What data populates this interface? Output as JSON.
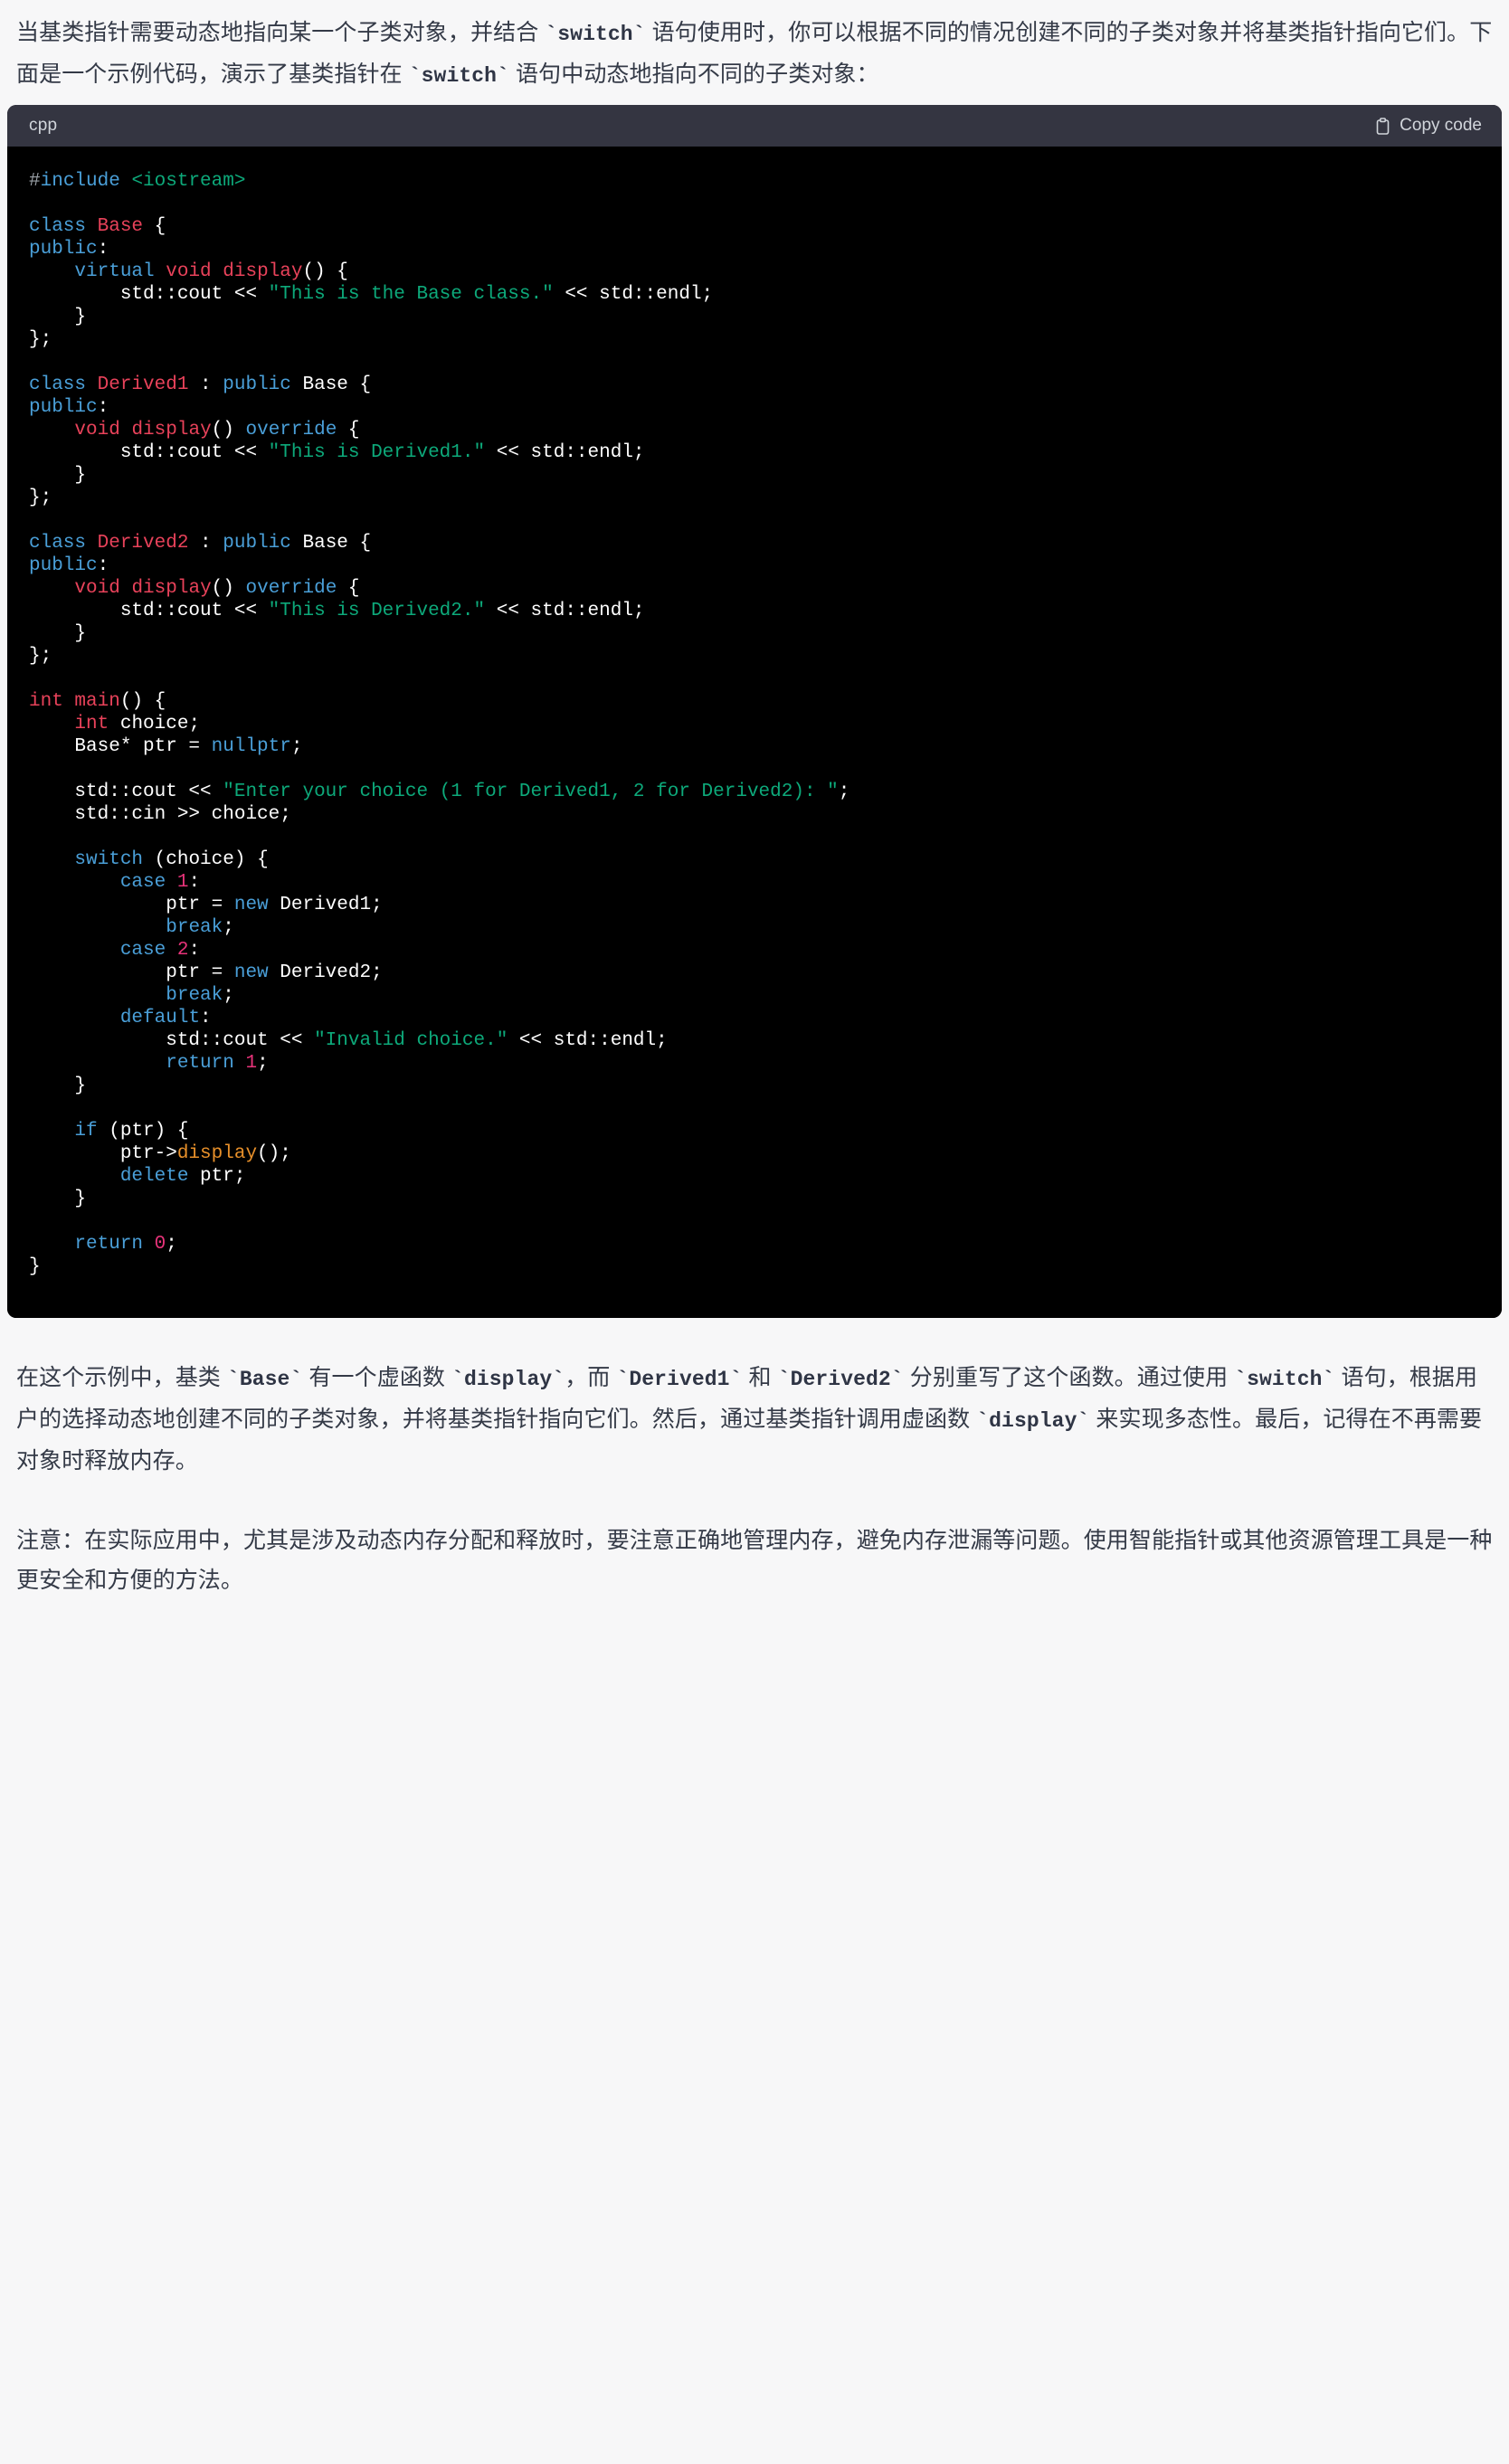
{
  "intro": {
    "paragraph": "当基类指针需要动态地指向某一个子类对象，并结合 `switch` 语句使用时，你可以根据不同的情况创建不同的子类对象并将基类指针指向它们。下面是一个示例代码，演示了基类指针在 `switch` 语句中动态地指向不同的子类对象："
  },
  "code_block": {
    "language_label": "cpp",
    "copy_label": "Copy code",
    "copy_icon": "clipboard-icon",
    "header_bg": "#343541",
    "body_bg": "#000000",
    "lines": [
      [
        {
          "t": "hash",
          "s": "#"
        },
        {
          "t": "kw",
          "s": "include"
        },
        {
          "t": "plain",
          "s": " "
        },
        {
          "t": "str",
          "s": "<iostream>"
        }
      ],
      [],
      [
        {
          "t": "kw",
          "s": "class"
        },
        {
          "t": "plain",
          "s": " "
        },
        {
          "t": "type",
          "s": "Base"
        },
        {
          "t": "plain",
          "s": " {"
        }
      ],
      [
        {
          "t": "kw",
          "s": "public"
        },
        {
          "t": "plain",
          "s": ":"
        }
      ],
      [
        {
          "t": "plain",
          "s": "    "
        },
        {
          "t": "kw",
          "s": "virtual"
        },
        {
          "t": "plain",
          "s": " "
        },
        {
          "t": "type",
          "s": "void"
        },
        {
          "t": "plain",
          "s": " "
        },
        {
          "t": "type",
          "s": "display"
        },
        {
          "t": "plain",
          "s": "() {"
        }
      ],
      [
        {
          "t": "plain",
          "s": "        std::cout << "
        },
        {
          "t": "str",
          "s": "\"This is the Base class.\""
        },
        {
          "t": "plain",
          "s": " << std::endl;"
        }
      ],
      [
        {
          "t": "plain",
          "s": "    }"
        }
      ],
      [
        {
          "t": "plain",
          "s": "};"
        }
      ],
      [],
      [
        {
          "t": "kw",
          "s": "class"
        },
        {
          "t": "plain",
          "s": " "
        },
        {
          "t": "type",
          "s": "Derived1"
        },
        {
          "t": "plain",
          "s": " : "
        },
        {
          "t": "kw",
          "s": "public"
        },
        {
          "t": "plain",
          "s": " Base {"
        }
      ],
      [
        {
          "t": "kw",
          "s": "public"
        },
        {
          "t": "plain",
          "s": ":"
        }
      ],
      [
        {
          "t": "plain",
          "s": "    "
        },
        {
          "t": "type",
          "s": "void"
        },
        {
          "t": "plain",
          "s": " "
        },
        {
          "t": "type",
          "s": "display"
        },
        {
          "t": "plain",
          "s": "() "
        },
        {
          "t": "kw",
          "s": "override"
        },
        {
          "t": "plain",
          "s": " {"
        }
      ],
      [
        {
          "t": "plain",
          "s": "        std::cout << "
        },
        {
          "t": "str",
          "s": "\"This is Derived1.\""
        },
        {
          "t": "plain",
          "s": " << std::endl;"
        }
      ],
      [
        {
          "t": "plain",
          "s": "    }"
        }
      ],
      [
        {
          "t": "plain",
          "s": "};"
        }
      ],
      [],
      [
        {
          "t": "kw",
          "s": "class"
        },
        {
          "t": "plain",
          "s": " "
        },
        {
          "t": "type",
          "s": "Derived2"
        },
        {
          "t": "plain",
          "s": " : "
        },
        {
          "t": "kw",
          "s": "public"
        },
        {
          "t": "plain",
          "s": " Base {"
        }
      ],
      [
        {
          "t": "kw",
          "s": "public"
        },
        {
          "t": "plain",
          "s": ":"
        }
      ],
      [
        {
          "t": "plain",
          "s": "    "
        },
        {
          "t": "type",
          "s": "void"
        },
        {
          "t": "plain",
          "s": " "
        },
        {
          "t": "type",
          "s": "display"
        },
        {
          "t": "plain",
          "s": "() "
        },
        {
          "t": "kw",
          "s": "override"
        },
        {
          "t": "plain",
          "s": " {"
        }
      ],
      [
        {
          "t": "plain",
          "s": "        std::cout << "
        },
        {
          "t": "str",
          "s": "\"This is Derived2.\""
        },
        {
          "t": "plain",
          "s": " << std::endl;"
        }
      ],
      [
        {
          "t": "plain",
          "s": "    }"
        }
      ],
      [
        {
          "t": "plain",
          "s": "};"
        }
      ],
      [],
      [
        {
          "t": "type",
          "s": "int"
        },
        {
          "t": "plain",
          "s": " "
        },
        {
          "t": "type",
          "s": "main"
        },
        {
          "t": "plain",
          "s": "() {"
        }
      ],
      [
        {
          "t": "plain",
          "s": "    "
        },
        {
          "t": "type",
          "s": "int"
        },
        {
          "t": "plain",
          "s": " choice;"
        }
      ],
      [
        {
          "t": "plain",
          "s": "    Base* ptr = "
        },
        {
          "t": "kw",
          "s": "nullptr"
        },
        {
          "t": "plain",
          "s": ";"
        }
      ],
      [],
      [
        {
          "t": "plain",
          "s": "    std::cout << "
        },
        {
          "t": "str",
          "s": "\"Enter your choice (1 for Derived1, 2 for Derived2): \""
        },
        {
          "t": "plain",
          "s": ";"
        }
      ],
      [
        {
          "t": "plain",
          "s": "    std::cin >> choice;"
        }
      ],
      [],
      [
        {
          "t": "plain",
          "s": "    "
        },
        {
          "t": "kw",
          "s": "switch"
        },
        {
          "t": "plain",
          "s": " (choice) {"
        }
      ],
      [
        {
          "t": "plain",
          "s": "        "
        },
        {
          "t": "kw",
          "s": "case"
        },
        {
          "t": "plain",
          "s": " "
        },
        {
          "t": "num",
          "s": "1"
        },
        {
          "t": "plain",
          "s": ":"
        }
      ],
      [
        {
          "t": "plain",
          "s": "            ptr = "
        },
        {
          "t": "kw",
          "s": "new"
        },
        {
          "t": "plain",
          "s": " Derived1;"
        }
      ],
      [
        {
          "t": "plain",
          "s": "            "
        },
        {
          "t": "kw",
          "s": "break"
        },
        {
          "t": "plain",
          "s": ";"
        }
      ],
      [
        {
          "t": "plain",
          "s": "        "
        },
        {
          "t": "kw",
          "s": "case"
        },
        {
          "t": "plain",
          "s": " "
        },
        {
          "t": "num",
          "s": "2"
        },
        {
          "t": "plain",
          "s": ":"
        }
      ],
      [
        {
          "t": "plain",
          "s": "            ptr = "
        },
        {
          "t": "kw",
          "s": "new"
        },
        {
          "t": "plain",
          "s": " Derived2;"
        }
      ],
      [
        {
          "t": "plain",
          "s": "            "
        },
        {
          "t": "kw",
          "s": "break"
        },
        {
          "t": "plain",
          "s": ";"
        }
      ],
      [
        {
          "t": "plain",
          "s": "        "
        },
        {
          "t": "kw",
          "s": "default"
        },
        {
          "t": "plain",
          "s": ":"
        }
      ],
      [
        {
          "t": "plain",
          "s": "            std::cout << "
        },
        {
          "t": "str",
          "s": "\"Invalid choice.\""
        },
        {
          "t": "plain",
          "s": " << std::endl;"
        }
      ],
      [
        {
          "t": "plain",
          "s": "            "
        },
        {
          "t": "kw",
          "s": "return"
        },
        {
          "t": "plain",
          "s": " "
        },
        {
          "t": "num",
          "s": "1"
        },
        {
          "t": "plain",
          "s": ";"
        }
      ],
      [
        {
          "t": "plain",
          "s": "    }"
        }
      ],
      [],
      [
        {
          "t": "plain",
          "s": "    "
        },
        {
          "t": "kw",
          "s": "if"
        },
        {
          "t": "plain",
          "s": " (ptr) {"
        }
      ],
      [
        {
          "t": "plain",
          "s": "        ptr->"
        },
        {
          "t": "fn",
          "s": "display"
        },
        {
          "t": "plain",
          "s": "();"
        }
      ],
      [
        {
          "t": "plain",
          "s": "        "
        },
        {
          "t": "kw",
          "s": "delete"
        },
        {
          "t": "plain",
          "s": " ptr;"
        }
      ],
      [
        {
          "t": "plain",
          "s": "    }"
        }
      ],
      [],
      [
        {
          "t": "plain",
          "s": "    "
        },
        {
          "t": "kw",
          "s": "return"
        },
        {
          "t": "plain",
          "s": " "
        },
        {
          "t": "num",
          "s": "0"
        },
        {
          "t": "plain",
          "s": ";"
        }
      ],
      [
        {
          "t": "plain",
          "s": "}"
        }
      ]
    ]
  },
  "explanation": {
    "paragraph": "在这个示例中，基类 `Base` 有一个虚函数 `display`，而 `Derived1` 和 `Derived2` 分别重写了这个函数。通过使用 `switch` 语句，根据用户的选择动态地创建不同的子类对象，并将基类指针指向它们。然后，通过基类指针调用虚函数 `display` 来实现多态性。最后，记得在不再需要对象时释放内存。",
    "note": "注意：在实际应用中，尤其是涉及动态内存分配和释放时，要注意正确地管理内存，避免内存泄漏等问题。使用智能指针或其他资源管理工具是一种更安全和方便的方法。"
  }
}
